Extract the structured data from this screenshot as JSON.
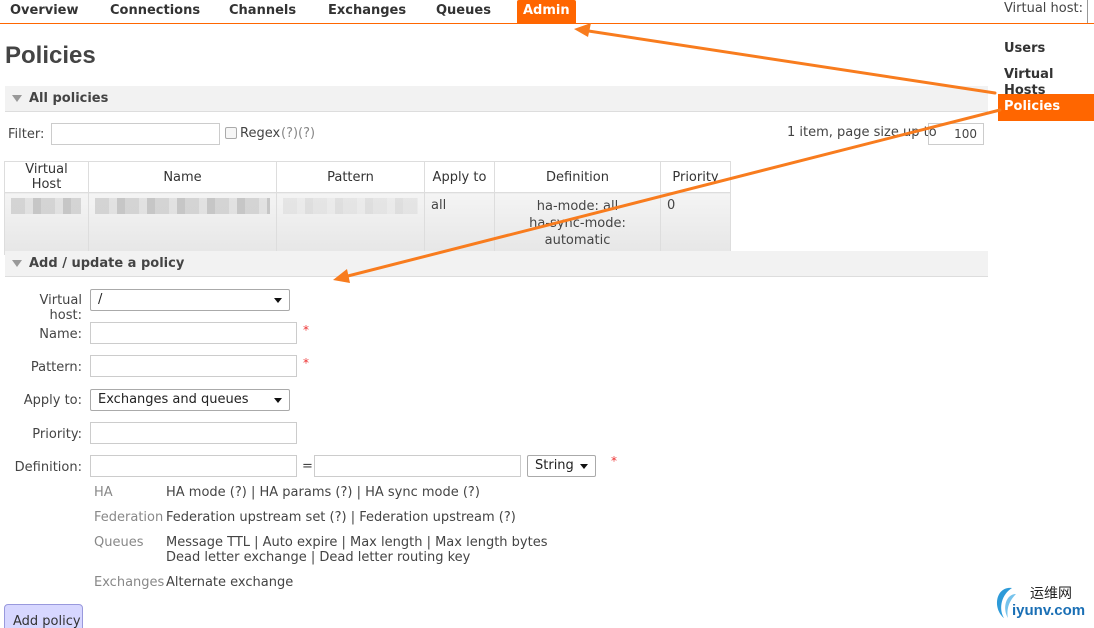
{
  "nav": {
    "tabs": [
      {
        "label": "Overview"
      },
      {
        "label": "Connections"
      },
      {
        "label": "Channels"
      },
      {
        "label": "Exchanges"
      },
      {
        "label": "Queues"
      },
      {
        "label": "Admin",
        "active": true
      }
    ],
    "vhost_label": "Virtual host:"
  },
  "page_title": "Policies",
  "sidebar": {
    "items": [
      {
        "label": "Users"
      },
      {
        "label": "Virtual Hosts"
      },
      {
        "label": "Policies",
        "active": true
      }
    ]
  },
  "all_policies": {
    "title": "All policies",
    "filter_label": "Filter:",
    "filter_value": "",
    "regex_label": "Regex",
    "regex_help": "(?)(?)",
    "paging_text": "1 item, page size up to",
    "page_size": "100",
    "columns": [
      "Virtual Host",
      "Name",
      "Pattern",
      "Apply to",
      "Definition",
      "Priority"
    ],
    "rows": [
      {
        "apply_to": "all",
        "definition_1": "ha-mode: all",
        "definition_2": "ha-sync-mode: automatic",
        "priority": "0"
      }
    ]
  },
  "add_policy": {
    "title": "Add / update a policy",
    "virtual_host_label": "Virtual host:",
    "virtual_host_value": "/",
    "name_label": "Name:",
    "pattern_label": "Pattern:",
    "apply_to_label": "Apply to:",
    "apply_to_value": "Exchanges and queues",
    "priority_label": "Priority:",
    "definition_label": "Definition:",
    "definition_eq": "=",
    "definition_type": "String",
    "required_mark": "*",
    "groups": {
      "ha": {
        "label": "HA",
        "line1": "HA mode (?) | HA params (?) | HA sync mode (?)"
      },
      "federation": {
        "label": "Federation",
        "line1": "Federation upstream set (?) | Federation upstream (?)"
      },
      "queues": {
        "label": "Queues",
        "line1": "Message TTL | Auto expire | Max length | Max length bytes",
        "line2": "Dead letter exchange | Dead letter routing key"
      },
      "exchanges": {
        "label": "Exchanges",
        "line1": "Alternate exchange"
      }
    },
    "submit_label": "Add policy"
  },
  "watermark": {
    "line1": "运维网",
    "line2": "iyunv.com"
  },
  "colors": {
    "accent": "#ff6600",
    "button": "#d7d7ff"
  }
}
